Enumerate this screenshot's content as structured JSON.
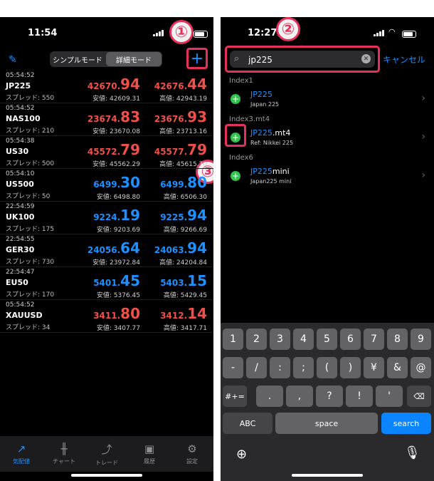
{
  "left": {
    "status_time": "11:54",
    "mode_simple": "シンプルモード",
    "mode_detail": "詳細モード",
    "marker1": "①",
    "marker3": "③",
    "quotes": [
      {
        "time": "05:54:52",
        "symbol": "JP225",
        "spread": "スプレッド: 550",
        "bid_main": "42670.",
        "bid_big": "94",
        "ask_main": "42676.",
        "ask_big": "44",
        "low": "安値: 42609.31",
        "high": "高値: 42943.19",
        "color": "#f0504a"
      },
      {
        "time": "05:54:52",
        "symbol": "NAS100",
        "spread": "スプレッド: 210",
        "bid_main": "23674.",
        "bid_big": "83",
        "ask_main": "23676.",
        "ask_big": "93",
        "low": "安値: 23670.08",
        "high": "高値: 23713.16",
        "color": "#f0504a"
      },
      {
        "time": "05:54:38",
        "symbol": "US30",
        "spread": "スプレッド: 500",
        "bid_main": "45572.",
        "bid_big": "79",
        "ask_main": "45577.",
        "ask_big": "79",
        "low": "安値: 45562.29",
        "high": "高値: 45615.70",
        "color": "#f0504a"
      },
      {
        "time": "05:54:10",
        "symbol": "US500",
        "spread": "スプレッド: 50",
        "bid_main": "6499.",
        "bid_big": "30",
        "ask_main": "6499.",
        "ask_big": "80",
        "low": "安値: 6498.80",
        "high": "高値: 6506.30",
        "color": "#1e90ff"
      },
      {
        "time": "22:54:59",
        "symbol": "UK100",
        "spread": "スプレッド: 175",
        "bid_main": "9224.",
        "bid_big": "19",
        "ask_main": "9225.",
        "ask_big": "94",
        "low": "安値: 9203.69",
        "high": "高値: 9266.69",
        "color": "#1e90ff"
      },
      {
        "time": "22:54:55",
        "symbol": "GER30",
        "spread": "スプレッド: 730",
        "bid_main": "24056.",
        "bid_big": "64",
        "ask_main": "24063.",
        "ask_big": "94",
        "low": "安値: 23972.84",
        "high": "高値: 24204.84",
        "color": "#1e90ff"
      },
      {
        "time": "22:54:47",
        "symbol": "EU50",
        "spread": "スプレッド: 170",
        "bid_main": "5401.",
        "bid_big": "45",
        "ask_main": "5403.",
        "ask_big": "15",
        "low": "安値: 5376.45",
        "high": "高値: 5429.45",
        "color": "#1e90ff"
      },
      {
        "time": "05:54:52",
        "symbol": "XAUUSD",
        "spread": "スプレッド: 34",
        "bid_main": "3411.",
        "bid_big": "80",
        "ask_main": "3412.",
        "ask_big": "14",
        "low": "安値: 3407.77",
        "high": "高値: 3417.71",
        "color": "#f0504a"
      }
    ],
    "nav": [
      "気配値",
      "チャート",
      "トレード",
      "履歴",
      "設定"
    ]
  },
  "right": {
    "status_time": "12:27",
    "marker2": "②",
    "search_value": "jp225",
    "cancel": "キャンセル",
    "groups": [
      {
        "label": "Index1",
        "items": [
          {
            "hl": "JP225",
            "rest": "",
            "desc": "Japan 225"
          }
        ]
      },
      {
        "label": "Index3.mt4",
        "items": [
          {
            "hl": "JP225",
            "rest": ".mt4",
            "desc": "Ref: Nikkei 225"
          }
        ]
      },
      {
        "label": "Index6",
        "items": [
          {
            "hl": "JP225",
            "rest": "mini",
            "desc": "Japan225 mini"
          }
        ]
      }
    ],
    "keys_row1": [
      "1",
      "2",
      "3",
      "4",
      "5",
      "6",
      "7",
      "8",
      "9"
    ],
    "keys_row2": [
      "-",
      "/",
      ":",
      ";",
      "(",
      ")",
      "¥",
      "&",
      "@"
    ],
    "keys_row3": [
      "#+=",
      ".",
      ",",
      "?",
      "!",
      "'"
    ],
    "abc": "ABC",
    "space": "space",
    "search": "search"
  }
}
